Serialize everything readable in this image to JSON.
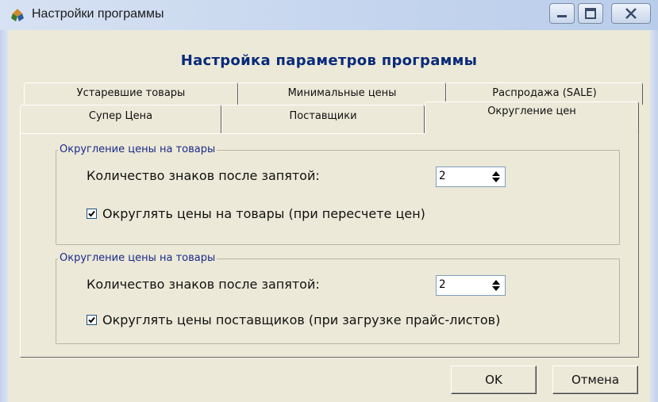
{
  "window": {
    "title": "Настройки программы",
    "controls": [
      "minimize-icon",
      "maximize-icon",
      "close-icon"
    ]
  },
  "heading": "Настройка параметров программы",
  "tabs": {
    "row1": [
      "Устаревшие товары",
      "Минимальные цены",
      "Распродажа (SALE)"
    ],
    "row2": [
      "Супер Цена",
      "Поставщики",
      "Округление цен"
    ],
    "active": "Округление цен"
  },
  "group1": {
    "label": "Округление цены на товары",
    "field_label": "Количество знаков после запятой:",
    "value": "2",
    "checkbox_label": "Округлять цены на товары (при пересчете цен)",
    "checked": true
  },
  "group2": {
    "label": "Округление цены на товары",
    "field_label": "Количество знаков после запятой:",
    "value": "2",
    "checkbox_label": "Округлять цены поставщиков (при загрузке прайс-листов)",
    "checked": true
  },
  "buttons": {
    "ok": "OK",
    "cancel": "Отмена"
  },
  "colors": {
    "heading": "#0a2a7a",
    "group_label": "#1a2a8a",
    "dialog_bg": "#ece9d8"
  }
}
